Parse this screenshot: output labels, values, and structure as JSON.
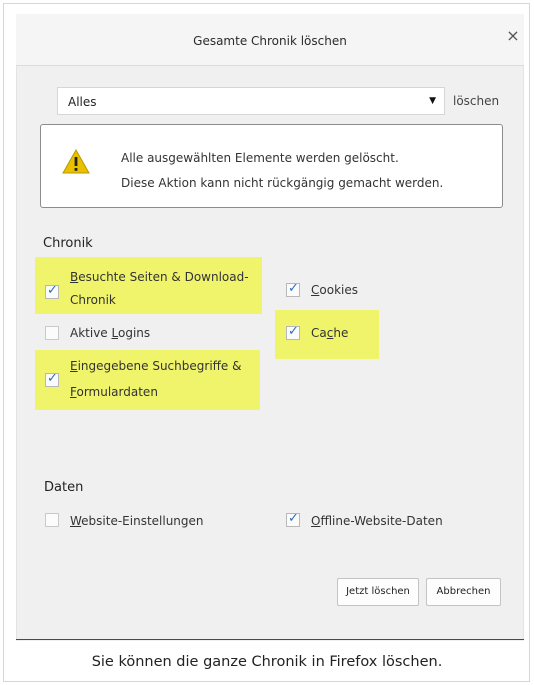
{
  "dialog": {
    "title": "Gesamte Chronik löschen",
    "close_glyph": "×",
    "range": {
      "selected": "Alles",
      "suffix": "löschen"
    },
    "warning": {
      "line1": "Alle ausgewählten Elemente werden gelöscht.",
      "line2": "Diese Aktion kann nicht rückgängig gemacht werden."
    },
    "chronik": {
      "heading": "Chronik",
      "items": [
        {
          "label_a": "B",
          "label_b": "esuchte Seiten & Download-",
          "label_c": "Chronik",
          "checked": true,
          "highlighted": true
        },
        {
          "label_a": "Aktive ",
          "label_b": "L",
          "label_c": "ogins",
          "checked": false,
          "highlighted": false
        },
        {
          "label_a": "E",
          "label_b": "ingegebene Suchbegriffe &",
          "label_c": "F",
          "label_d": "ormulardaten",
          "checked": true,
          "highlighted": true
        },
        {
          "label_a": "C",
          "label_b": "ookies",
          "checked": true,
          "highlighted": false
        },
        {
          "label_a": "Ca",
          "label_b": "c",
          "label_c": "he",
          "checked": true,
          "highlighted": true
        }
      ]
    },
    "daten": {
      "heading": "Daten",
      "items": [
        {
          "label_a": "W",
          "label_b": "ebsite-Einstellungen",
          "checked": false
        },
        {
          "label_a": "O",
          "label_b": "ffline-Website-Daten",
          "checked": true
        }
      ]
    },
    "buttons": {
      "confirm": "Jetzt löschen",
      "cancel": "Abbrechen"
    }
  },
  "caption": "Sie können die ganze Chronik in Firefox löschen.",
  "colors": {
    "highlight": "#f0f46b",
    "check": "#2a6ebd",
    "warning_triangle": "#e8c000"
  },
  "icons": {
    "warning": "warning-triangle-icon",
    "check": "checkmark-icon",
    "dropdown": "dropdown-arrow-icon",
    "close": "close-icon"
  }
}
